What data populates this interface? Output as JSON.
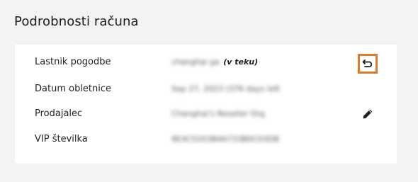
{
  "section": {
    "title": "Podrobnosti računa"
  },
  "rows": [
    {
      "label": "Lastnik pogodbe",
      "value": "changhai ga",
      "suffix": "(v teku)"
    },
    {
      "label": "Datum obletnice",
      "value": "Sep 27, 2023 (376 days left"
    },
    {
      "label": "Prodajalec",
      "value": "Changhai's Reseller Org"
    },
    {
      "label": "VIP številka",
      "value": "9E4C5203B4A733B0C03DB"
    }
  ],
  "actions": {
    "undo_icon": "undo-icon",
    "edit_icon": "pencil-icon",
    "highlight_color": "#e07b2e"
  }
}
